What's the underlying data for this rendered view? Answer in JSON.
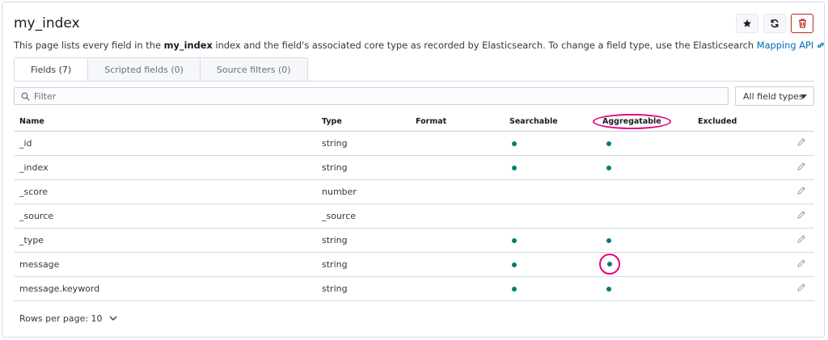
{
  "page": {
    "title": "my_index",
    "desc_prefix": "This page lists every field in the ",
    "desc_index": "my_index",
    "desc_middle": " index and the field's associated core type as recorded by Elasticsearch. To change a field type, use the Elasticsearch ",
    "desc_link": "Mapping API"
  },
  "header_buttons": {
    "star_icon": "star-icon",
    "refresh_icon": "refresh-icon",
    "delete_icon": "trash-icon",
    "delete_color": "#bd271e"
  },
  "tabs": [
    {
      "label": "Fields (7)",
      "active": true
    },
    {
      "label": "Scripted fields (0)",
      "active": false
    },
    {
      "label": "Source filters (0)",
      "active": false
    }
  ],
  "filter": {
    "placeholder": "Filter",
    "value": ""
  },
  "type_select": {
    "value": "All field types"
  },
  "table": {
    "headers": {
      "name": "Name",
      "type": "Type",
      "format": "Format",
      "searchable": "Searchable",
      "aggregatable": "Aggregatable",
      "excluded": "Excluded"
    },
    "rows": [
      {
        "name": "_id",
        "type": "string",
        "searchable": true,
        "aggregatable": true
      },
      {
        "name": "_index",
        "type": "string",
        "searchable": true,
        "aggregatable": true
      },
      {
        "name": "_score",
        "type": "number",
        "searchable": false,
        "aggregatable": false
      },
      {
        "name": "_source",
        "type": "_source",
        "searchable": false,
        "aggregatable": false
      },
      {
        "name": "_type",
        "type": "string",
        "searchable": true,
        "aggregatable": true
      },
      {
        "name": "message",
        "type": "string",
        "searchable": true,
        "aggregatable": true
      },
      {
        "name": "message.keyword",
        "type": "string",
        "searchable": true,
        "aggregatable": true
      }
    ]
  },
  "pagination": {
    "label": "Rows per page: 10"
  },
  "colors": {
    "dot": "#017d73",
    "annotation": "#e2047f",
    "link": "#006bb4"
  }
}
